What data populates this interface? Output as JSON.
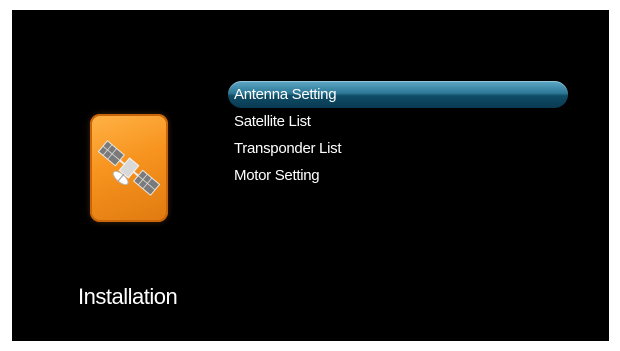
{
  "header": {
    "cropped_text": "▬▬▬▬▬ ▬▬ ▬▬▬▬▬▬▬"
  },
  "section": {
    "title": "Installation",
    "icon": "satellite-icon"
  },
  "menu": {
    "items": [
      {
        "label": "Antenna Setting",
        "selected": true
      },
      {
        "label": "Satellite List",
        "selected": false
      },
      {
        "label": "Transponder List",
        "selected": false
      },
      {
        "label": "Motor Setting",
        "selected": false
      }
    ]
  },
  "colors": {
    "background": "#000000",
    "icon_orange": "#f7931e",
    "highlight": "#2d7796",
    "text": "#ffffff"
  }
}
